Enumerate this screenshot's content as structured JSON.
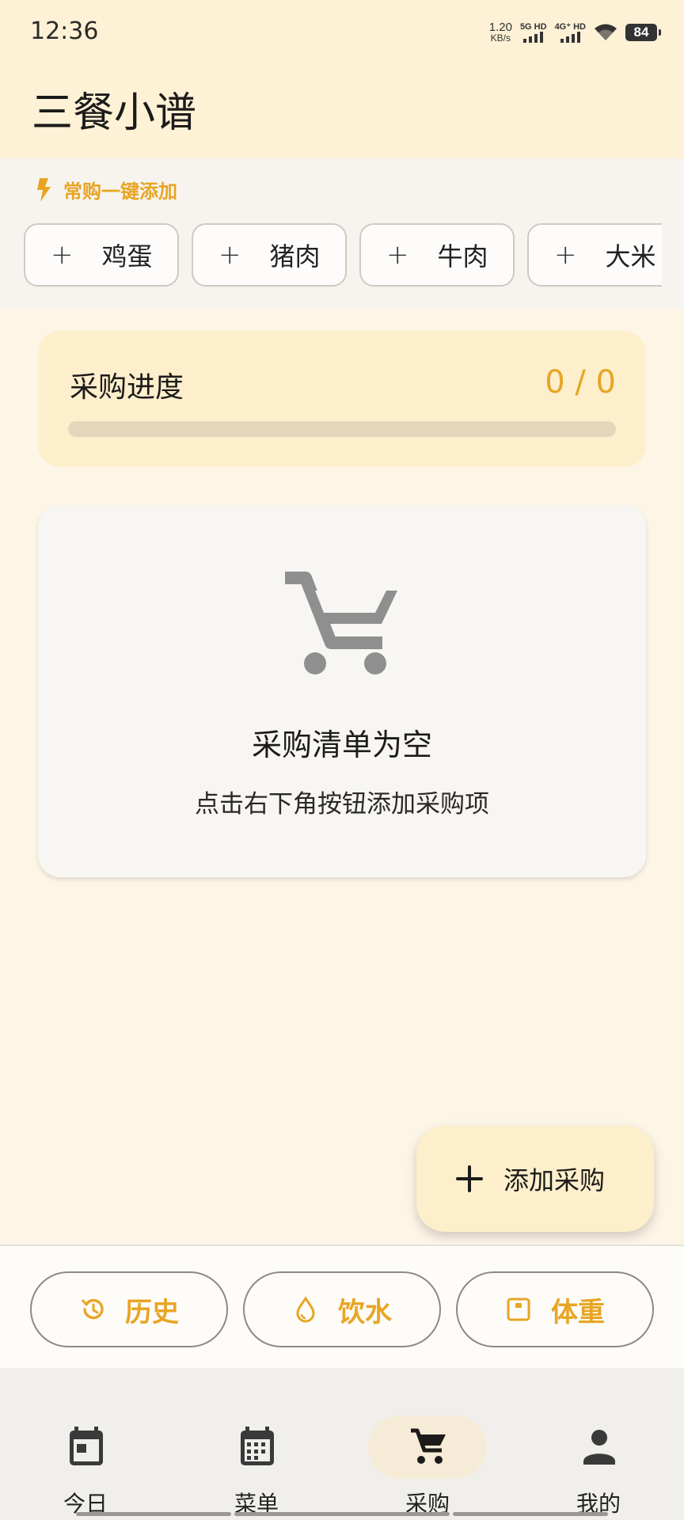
{
  "status": {
    "time": "12:36",
    "speed_value": "1.20",
    "speed_unit": "KB/s",
    "sim1": "5G HD",
    "sim2": "4G⁺ HD",
    "battery": "84"
  },
  "app": {
    "title": "三餐小谱"
  },
  "quick_add": {
    "title": "常购一键添加",
    "plus": "+",
    "items": [
      "鸡蛋",
      "猪肉",
      "牛肉",
      "大米"
    ]
  },
  "progress": {
    "title": "采购进度",
    "count": "0 / 0",
    "done": 0,
    "total": 0
  },
  "empty": {
    "title": "采购清单为空",
    "subtitle": "点击右下角按钮添加采购项"
  },
  "fab": {
    "label": "添加采购"
  },
  "actions": [
    {
      "label": "历史",
      "icon": "history-icon"
    },
    {
      "label": "饮水",
      "icon": "water-drop-icon"
    },
    {
      "label": "体重",
      "icon": "scale-icon"
    }
  ],
  "nav": [
    {
      "label": "今日",
      "icon": "calendar-today-icon",
      "active": false
    },
    {
      "label": "菜单",
      "icon": "calendar-month-icon",
      "active": false
    },
    {
      "label": "采购",
      "icon": "cart-icon",
      "active": true
    },
    {
      "label": "我的",
      "icon": "person-icon",
      "active": false
    }
  ],
  "colors": {
    "accent": "#e8a524",
    "header_bg": "#fdf1d6",
    "card_bg": "#fdefcc",
    "page_bg": "#fdf5e6"
  }
}
